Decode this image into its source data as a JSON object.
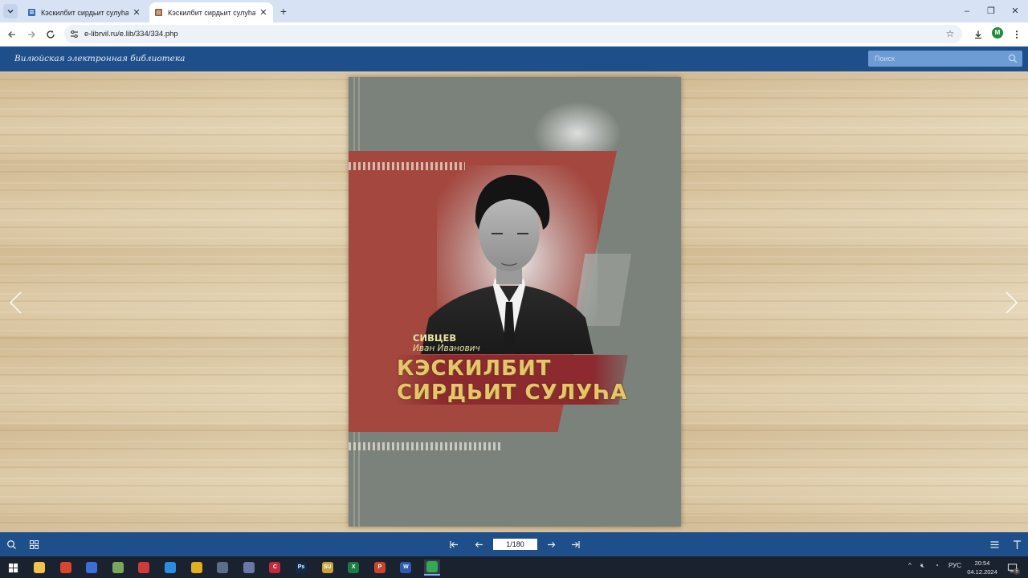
{
  "browser": {
    "tabs": [
      {
        "title": "Кэскилбит сирдьит сулуһа / сп",
        "active": false
      },
      {
        "title": "Кэскилбит сирдьит сулуһа : [с",
        "active": true
      }
    ],
    "new_tab_label": "+",
    "window_controls": {
      "minimize": "–",
      "restore": "❐",
      "close": "✕"
    },
    "url": "e-librvil.ru/e.lib/334/334.php",
    "profile_initial": "M"
  },
  "site": {
    "logo_text": "Вилюйская электронная библиотека",
    "search_placeholder": "Поиск"
  },
  "book": {
    "author_surname": "СИВЦЕВ",
    "author_name": "Иван Иванович",
    "title_line1": "КЭСКИЛБИТ",
    "title_line2": "СИРДЬИТ СУЛУҺА"
  },
  "reader_toolbar": {
    "page_indicator": "1/180"
  },
  "taskbar": {
    "apps": [
      {
        "name": "file-explorer",
        "label": "",
        "color": "#f2c14e"
      },
      {
        "name": "app-red",
        "label": "",
        "color": "#d9452e"
      },
      {
        "name": "chrome-alt",
        "label": "",
        "color": "#3b6fd8"
      },
      {
        "name": "app-green",
        "label": "",
        "color": "#7aa85a"
      },
      {
        "name": "app-pdf",
        "label": "",
        "color": "#d23a3a"
      },
      {
        "name": "app-blue-circle",
        "label": "",
        "color": "#2a8de0"
      },
      {
        "name": "app-yellow",
        "label": "",
        "color": "#e0b020"
      },
      {
        "name": "app-cloud",
        "label": "",
        "color": "#5a6e88"
      },
      {
        "name": "app-doc",
        "label": "",
        "color": "#6a78a8"
      },
      {
        "name": "app-c",
        "label": "C",
        "color": "#c22a3a"
      },
      {
        "name": "photoshop",
        "label": "Ps",
        "color": "#0f2a4a"
      },
      {
        "name": "app-su",
        "label": "SU",
        "color": "#caa43a"
      },
      {
        "name": "excel",
        "label": "X",
        "color": "#1d7a45"
      },
      {
        "name": "powerpoint",
        "label": "P",
        "color": "#c8462c"
      },
      {
        "name": "word",
        "label": "W",
        "color": "#2b5bb5"
      },
      {
        "name": "chrome",
        "label": "",
        "color": "#34a853"
      }
    ],
    "tray_language": "РУС",
    "clock_time": "20:54",
    "clock_date": "04.12.2024",
    "notification_count": "5"
  }
}
